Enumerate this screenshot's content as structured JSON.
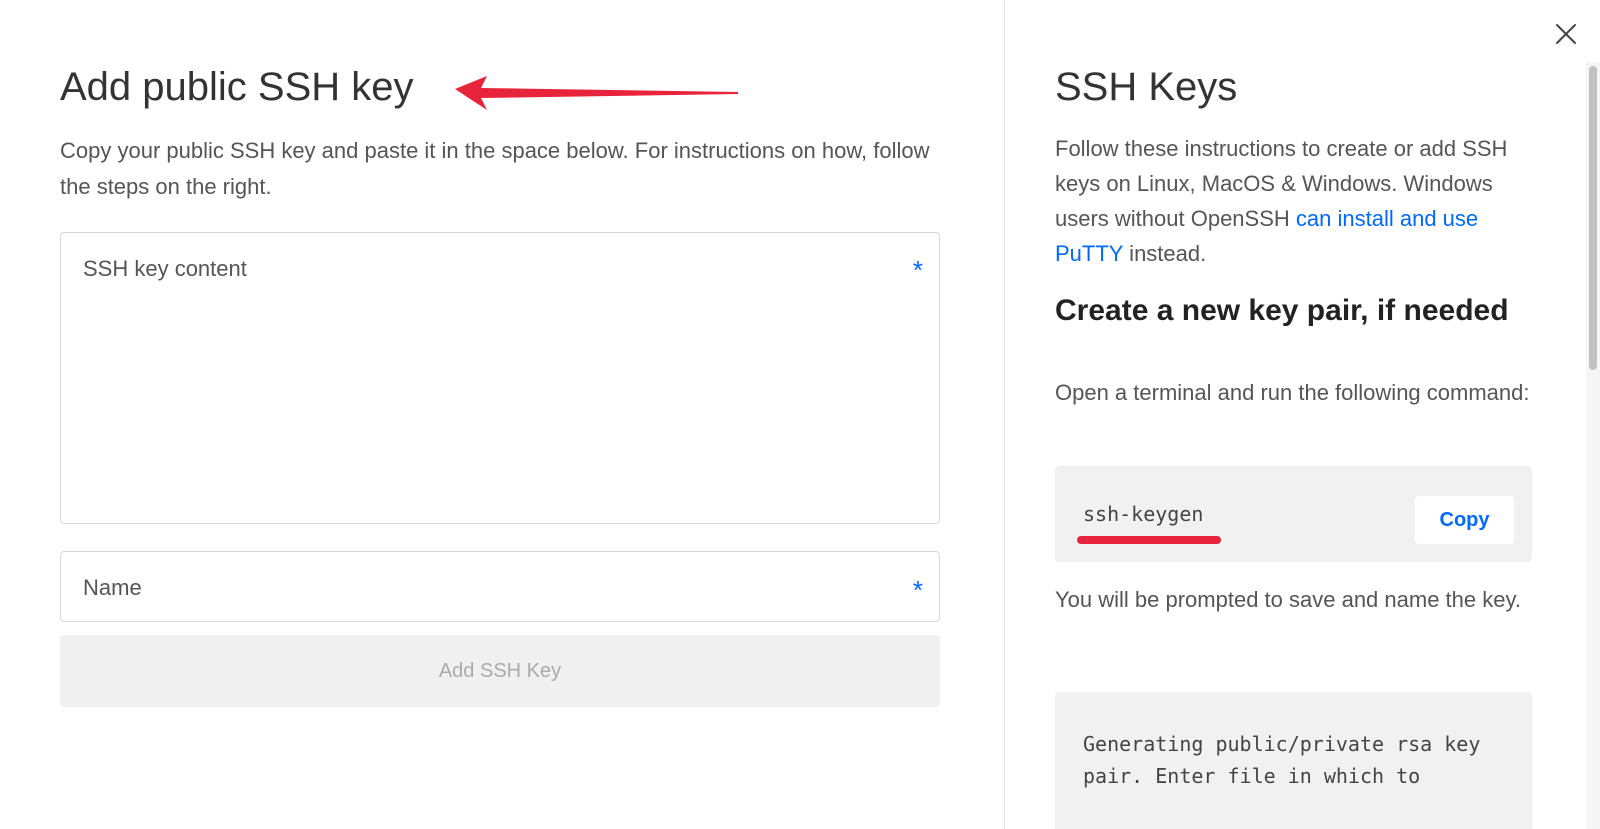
{
  "left": {
    "title": "Add public SSH key",
    "intro": "Copy your public SSH key and paste it in the space below. For instructions on how, follow the steps on the right.",
    "ssh_key_field": {
      "label": "SSH key content",
      "required_marker": "*",
      "value": ""
    },
    "name_field": {
      "label": "Name",
      "required_marker": "*",
      "value": ""
    },
    "submit_label": "Add SSH Key"
  },
  "right": {
    "title": "SSH Keys",
    "intro_text": "Follow these instructions to create or add SSH keys on Linux, MacOS & Windows. Windows users without OpenSSH ",
    "intro_link": "can install and use PuTTY",
    "intro_suffix": " instead.",
    "heading": "Create a new key pair, if needed",
    "step1": "Open a terminal and run the following command:",
    "command": "ssh-keygen",
    "copy_label": "Copy",
    "step2": "You will be prompted to save and name the key.",
    "output": "Generating public/private rsa key pair. Enter file in which to"
  },
  "icons": {
    "close": "close-icon",
    "arrow": "arrow-annotation-icon"
  },
  "colors": {
    "accent": "#0069ff",
    "annotation": "#e8243c"
  }
}
